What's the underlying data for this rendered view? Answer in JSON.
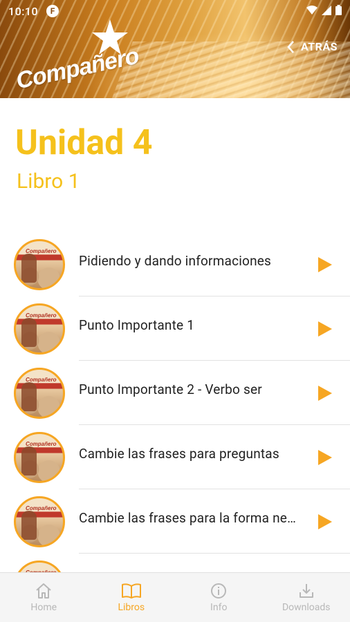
{
  "status_bar": {
    "time": "10:10",
    "app_badge": "F"
  },
  "header": {
    "logo_text": "Compañero",
    "back_label": "ATRÁS"
  },
  "page": {
    "title": "Unidad 4",
    "subtitle": "Libro 1"
  },
  "lessons": [
    {
      "title": "Pidiendo y dando informaciones"
    },
    {
      "title": "Punto Importante 1"
    },
    {
      "title": "Punto Importante 2 - Verbo ser"
    },
    {
      "title": "Cambie las frases para preguntas"
    },
    {
      "title": "Cambie las frases para la forma negativa"
    }
  ],
  "bottom_nav": {
    "items": [
      {
        "label": "Home",
        "icon": "home-icon"
      },
      {
        "label": "Libros",
        "icon": "book-icon",
        "active": true
      },
      {
        "label": "Info",
        "icon": "info-icon"
      },
      {
        "label": "Downloads",
        "icon": "download-icon"
      }
    ]
  },
  "colors": {
    "accent": "#f5c11c",
    "play": "#f6a623",
    "nav_inactive": "#b8b8b8"
  }
}
